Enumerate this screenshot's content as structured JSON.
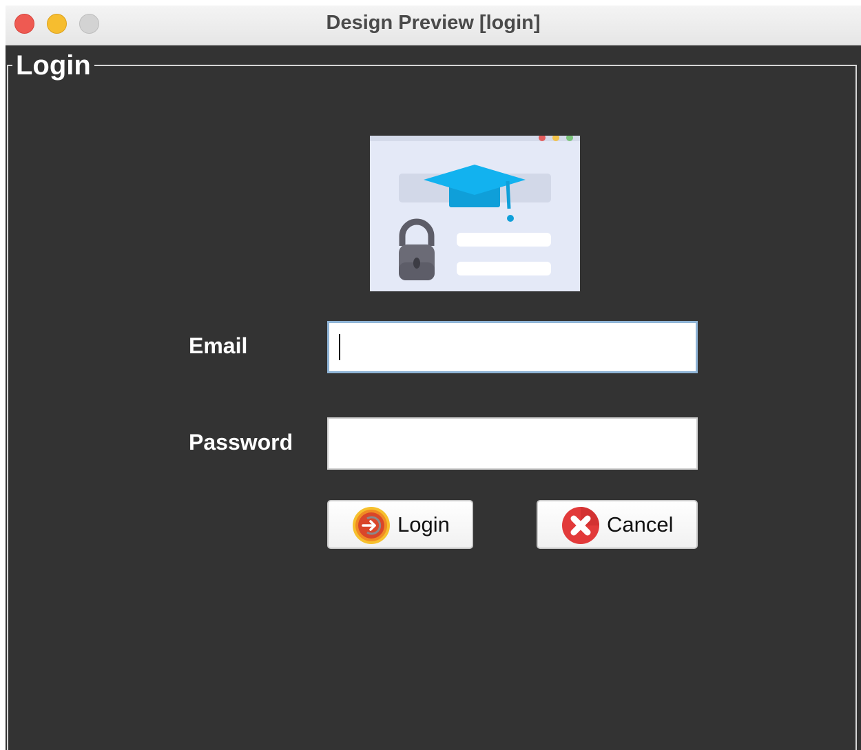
{
  "window": {
    "title": "Design Preview [login]"
  },
  "form": {
    "group_title": "Login",
    "email_label": "Email",
    "email_value": "",
    "password_label": "Password",
    "password_value": ""
  },
  "buttons": {
    "login_label": "Login",
    "cancel_label": "Cancel"
  },
  "icons": {
    "hero": "login-illustration-icon",
    "login": "login-arrow-icon",
    "cancel": "cancel-x-icon"
  },
  "colors": {
    "background": "#333333",
    "cap_blue": "#12b2ef",
    "lock_gray": "#6b6b76",
    "close_red": "#ee5a52",
    "minimize_yellow": "#f6bd2f",
    "cancel_red": "#e23a3a",
    "login_orange": "#f08a24"
  }
}
